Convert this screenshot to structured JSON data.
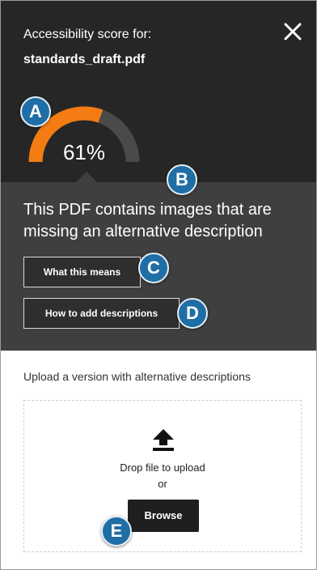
{
  "header": {
    "score_label": "Accessibility score for:",
    "filename": "standards_draft.pdf",
    "close_icon": "close-icon"
  },
  "score": {
    "percent_label": "61%",
    "value": 0.61,
    "fill_color": "#f47c12",
    "track_color": "#4a4a4a"
  },
  "issue": {
    "message": "This PDF contains images that are missing an alternative description",
    "what_this_means_label": "What this means",
    "how_to_add_label": "How to add descriptions"
  },
  "upload": {
    "label": "Upload a version with alternative descriptions",
    "upload_icon": "upload-icon",
    "drop_text": "Drop file to upload",
    "or_text": "or",
    "browse_label": "Browse"
  },
  "callouts": {
    "a": "A",
    "b": "B",
    "c": "C",
    "d": "D",
    "e": "E",
    "color": "#1f6ea6"
  }
}
